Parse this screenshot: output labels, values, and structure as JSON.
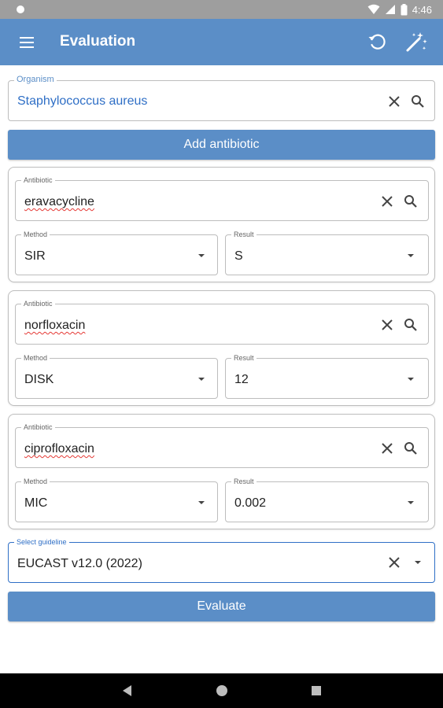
{
  "status_bar": {
    "time": "4:46"
  },
  "app_bar": {
    "title": "Evaluation"
  },
  "organism": {
    "label": "Organism",
    "value": "Staphylococcus aureus"
  },
  "add_antibiotic_label": "Add antibiotic",
  "antibiotics": [
    {
      "antibiotic_label": "Antibiotic",
      "antibiotic": "eravacycline",
      "method_label": "Method",
      "method": "SIR",
      "result_label": "Result",
      "result": "S"
    },
    {
      "antibiotic_label": "Antibiotic",
      "antibiotic": "norfloxacin",
      "method_label": "Method",
      "method": "DISK",
      "result_label": "Result",
      "result": "12"
    },
    {
      "antibiotic_label": "Antibiotic",
      "antibiotic": "ciprofloxacin",
      "method_label": "Method",
      "method": "MIC",
      "result_label": "Result",
      "result": "0.002"
    }
  ],
  "guideline": {
    "label": "Select guideline",
    "value": "EUCAST v12.0 (2022)"
  },
  "evaluate_label": "Evaluate",
  "colors": {
    "primary": "#5b8ec7",
    "accent": "#2f6fc6",
    "status_bar": "#9e9e9e",
    "spell_underline": "#e53935"
  }
}
